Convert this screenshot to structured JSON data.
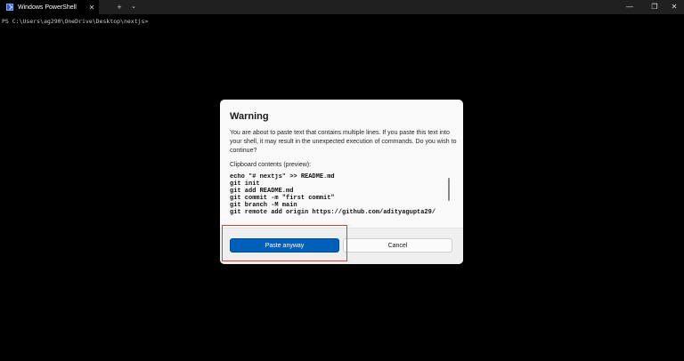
{
  "titlebar": {
    "tab_title": "Windows PowerShell",
    "tab_close": "✕",
    "new_tab": "+",
    "dropdown": "⌄",
    "minimize": "—",
    "maximize": "❐",
    "close": "✕"
  },
  "console": {
    "prompt": "PS C:\\Users\\ag290\\OneDrive\\Desktop\\nextjs>"
  },
  "dialog": {
    "title": "Warning",
    "message": "You are about to paste text that contains multiple lines. If you paste this text into your shell, it may result in the unexpected execution of commands. Do you wish to continue?",
    "preview_label": "Clipboard contents (preview):",
    "preview_lines": [
      "echo \"# nextjs\" >> README.md",
      "git init",
      "git add README.md",
      "git commit -m \"first commit\"",
      "git branch -M main",
      "git remote add origin https://github.com/adityagupta29/"
    ],
    "paste_button": "Paste anyway",
    "cancel_button": "Cancel"
  },
  "colors": {
    "primary": "#005fb8",
    "highlight": "#e23b3b",
    "background": "#000000"
  }
}
